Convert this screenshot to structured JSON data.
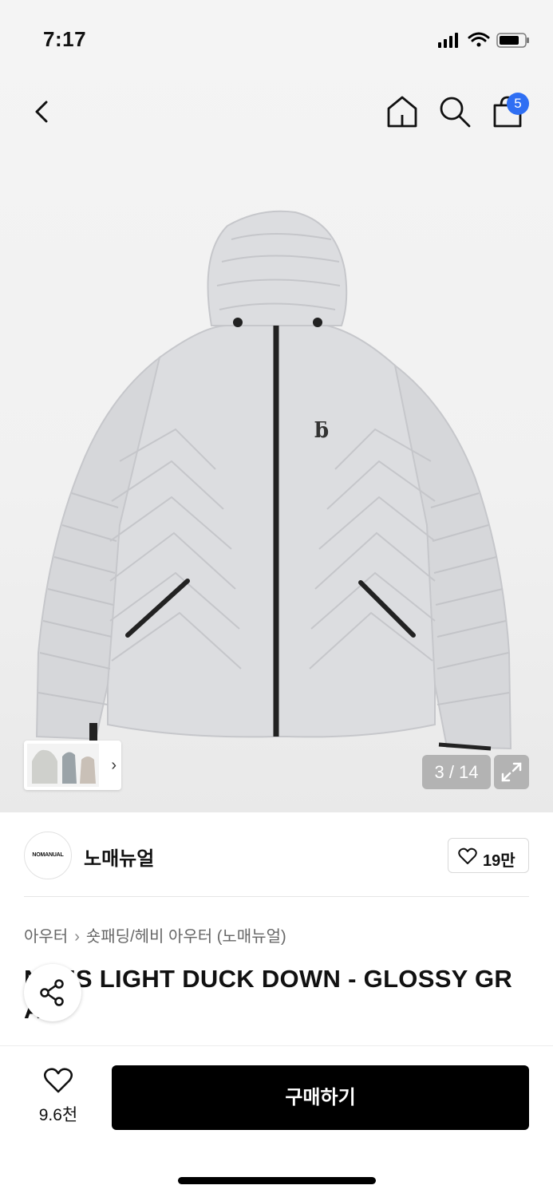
{
  "status_bar": {
    "time": "7:17"
  },
  "nav": {
    "cart_count": "5"
  },
  "gallery": {
    "counter": "3 / 14",
    "thumbnail_arrow": "›",
    "product_logo_glyph": "ƃ"
  },
  "brand": {
    "logo_text": "NOMANUAL",
    "name": "노매뉴얼",
    "like_count": "19만"
  },
  "breadcrumb": {
    "level1": "아우터",
    "separator": "›",
    "level2": "숏패딩/헤비 아우터 (노매뉴얼)"
  },
  "product": {
    "title_line1": "N··ES LIGHT DUCK DOWN - GLOSSY GR",
    "title_line2": "A"
  },
  "bottom_bar": {
    "wish_count": "9.6천",
    "buy_label": "구매하기"
  },
  "colors": {
    "accent_badge": "#2f6ff3",
    "buy_button": "#000000",
    "jacket": "#dcdde0"
  }
}
